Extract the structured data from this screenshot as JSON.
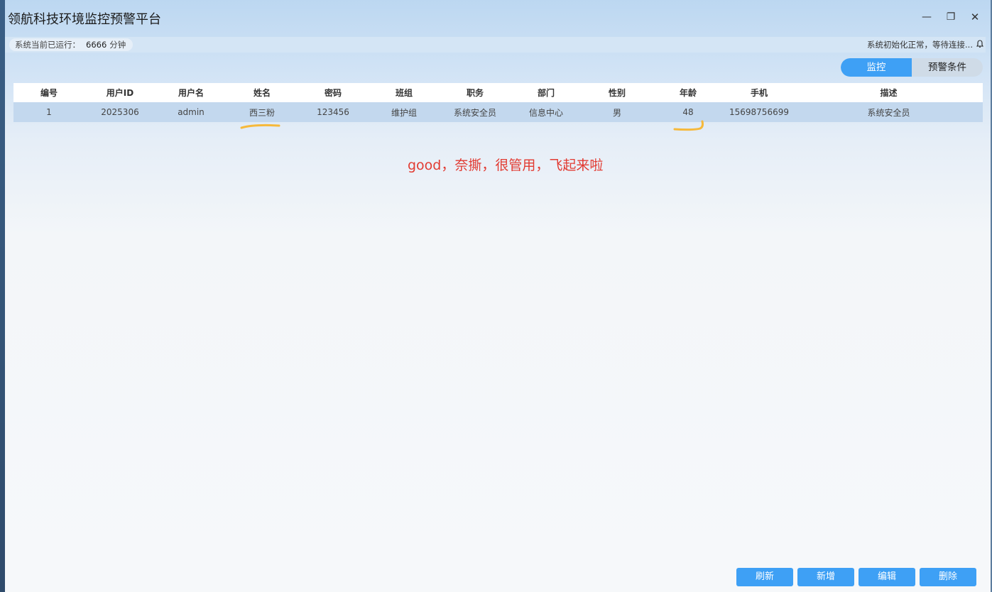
{
  "window": {
    "title": "领航科技环境监控预警平台",
    "controls": {
      "minimize": "—",
      "maximize": "❐",
      "close": "✕"
    }
  },
  "status": {
    "runtime_label": "系统当前已运行：",
    "runtime_value": "6666",
    "runtime_unit": "分钟",
    "message": "系统初始化正常，等待连接..."
  },
  "tabs": [
    {
      "label": "监控",
      "active": true
    },
    {
      "label": "预警条件",
      "active": false
    }
  ],
  "table": {
    "columns": [
      "编号",
      "用户ID",
      "用户名",
      "姓名",
      "密码",
      "班组",
      "职务",
      "部门",
      "性别",
      "年龄",
      "手机",
      "描述"
    ],
    "rows": [
      [
        "1",
        "2025306",
        "admin",
        "西三粉",
        "123456",
        "维护组",
        "系统安全员",
        "信息中心",
        "男",
        "48",
        "15698756699",
        "系统安全员"
      ]
    ]
  },
  "annotation": {
    "text": "good，奈撕，很管用，飞起来啦",
    "text_color": "#e23b32",
    "underline_color": "#f6b93b"
  },
  "actions": {
    "refresh": "刷新",
    "add": "新增",
    "edit": "编辑",
    "delete": "删除"
  },
  "colors": {
    "accent": "#3ea0f5",
    "row_selected": "#c3d8ee"
  }
}
